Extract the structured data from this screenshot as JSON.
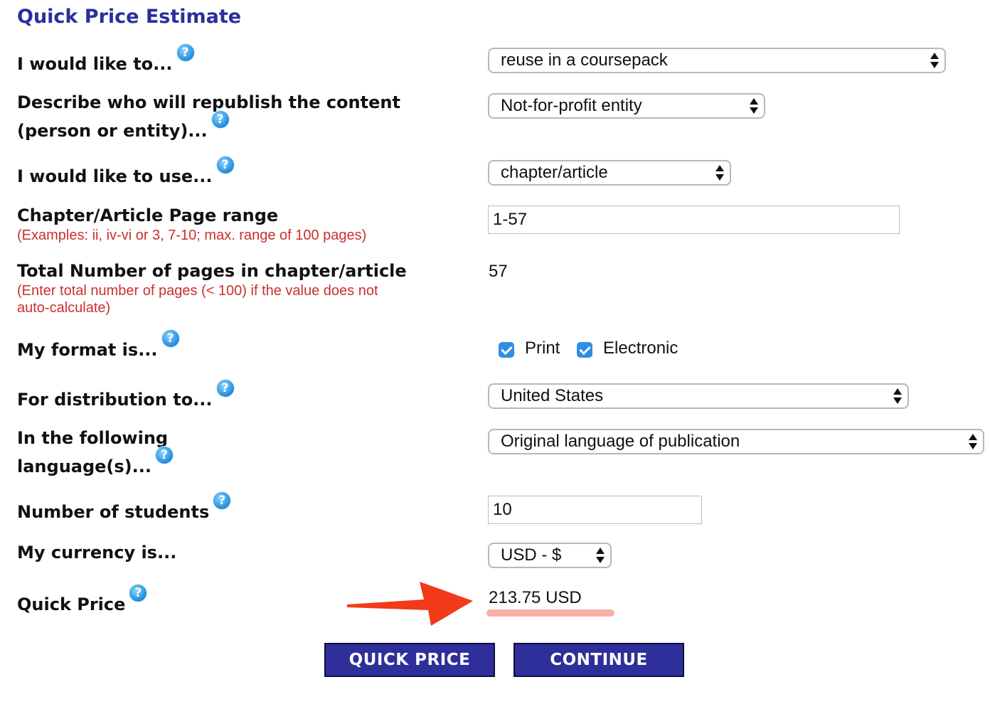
{
  "title": "Quick Price Estimate",
  "help_glyph": "?",
  "fields": {
    "would_like_to": {
      "label": "I would like to...",
      "value": "reuse in a coursepack"
    },
    "republisher": {
      "label_line1": "Describe who will republish the content",
      "label_line2": "(person or entity)...",
      "value": "Not-for-profit entity"
    },
    "use": {
      "label": "I would like to use...",
      "value": "chapter/article"
    },
    "page_range": {
      "label": "Chapter/Article Page range",
      "hint": "(Examples: ii, iv-vi or 3, 7-10; max. range of 100 pages)",
      "value": "1-57"
    },
    "total_pages": {
      "label": "Total Number of pages in chapter/article",
      "hint_line1": "(Enter total number of pages (< 100) if the value does not",
      "hint_line2": "auto-calculate)",
      "value": "57"
    },
    "format": {
      "label": "My format is...",
      "options": [
        {
          "label": "Print",
          "checked": true
        },
        {
          "label": "Electronic",
          "checked": true
        }
      ]
    },
    "distribution": {
      "label": "For distribution to...",
      "value": "United States"
    },
    "language": {
      "label_line1": "In the following",
      "label_line2": "language(s)...",
      "value": "Original language of publication"
    },
    "students": {
      "label": "Number of students",
      "value": "10"
    },
    "currency": {
      "label": "My currency is...",
      "value": "USD - $"
    },
    "quick_price": {
      "label": "Quick Price",
      "value": "213.75 USD"
    }
  },
  "buttons": {
    "quick_price": "QUICK PRICE",
    "continue": "CONTINUE"
  },
  "colors": {
    "title": "#2b2e9c",
    "hint": "#c9302c",
    "button": "#2e2f9b",
    "arrow": "#f23a1a",
    "highlight": "#f5a79c",
    "checkbox": "#2f8de4"
  }
}
